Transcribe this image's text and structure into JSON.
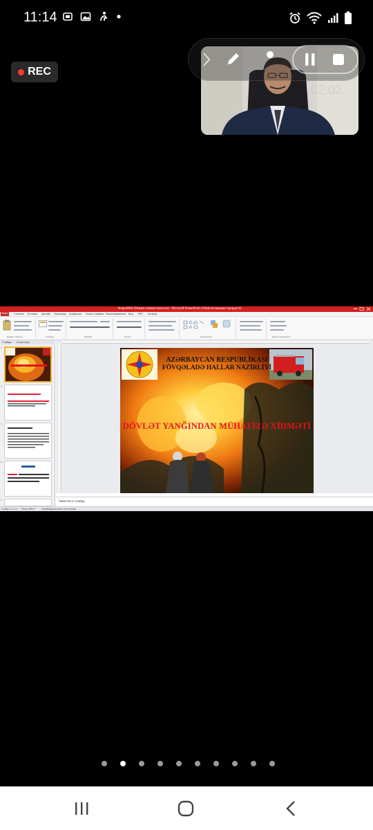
{
  "status_bar": {
    "time": "11:14",
    "left_icons": [
      "screen-capture-icon",
      "gallery-icon",
      "accessibility-icon",
      "notification-dot-icon"
    ],
    "right_icons": [
      "alarm-icon",
      "wifi-icon",
      "signal-icon",
      "battery-icon"
    ]
  },
  "recorder": {
    "rec_label": "REC",
    "timer": "02:02",
    "controls": [
      "chevron-right-icon",
      "pen-icon",
      "person-icon",
      "pause-icon",
      "stop-icon"
    ]
  },
  "powerpoint": {
    "window_title": "YanginMUH [Режим совместимости] - Microsoft PowerPoint (Сбой активации продукта)",
    "menu_tabs": [
      "Файл",
      "Главная",
      "Вставка",
      "Дизайн",
      "Переходы",
      "Анимация",
      "Показ слайдов",
      "Рецензирование",
      "Вид",
      "PDF",
      "Acrobat"
    ],
    "ribbon_groups": [
      "Буфер обмена",
      "Слайды",
      "Шрифт",
      "Абзац",
      "Рисование",
      "Редактирование"
    ],
    "pane_tabs": [
      "Слайды",
      "Структура"
    ],
    "thumb_numbers": [
      "1",
      "2",
      "3",
      "4",
      "5"
    ],
    "notes_placeholder": "Заметки к слайду",
    "status_items": [
      "Слайд 1 из 11",
      "\"Тема Office\"",
      "азербайджанский (латиница)"
    ],
    "slide": {
      "title_line1": "AZƏRBAYCAN RESPUBLİKASI",
      "title_line2": "FÖVQƏLADƏ HALLAR NAZİRLİYİ",
      "main_title": "DÖVLƏT YANĞINDAN MÜHAFİZƏ XİDMƏTİ"
    }
  },
  "pager": {
    "count": 10,
    "active_index": 1
  },
  "nav_bar": {
    "buttons": [
      "recents-icon",
      "home-icon",
      "back-icon"
    ]
  },
  "colors": {
    "rec_red": "#ff3b30",
    "ppt_red": "#d32020",
    "slide_title_red": "#e3141a",
    "thumb_selected": "#f2b233"
  }
}
